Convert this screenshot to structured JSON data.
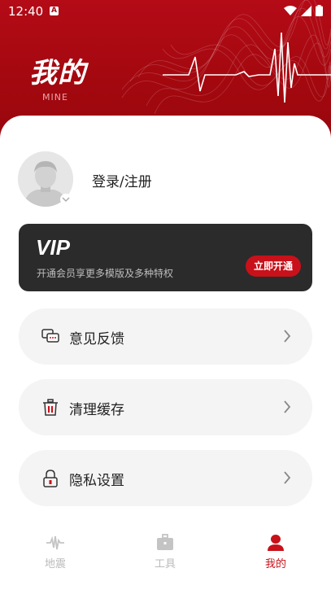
{
  "status_bar": {
    "time": "12:40",
    "app_badge": "A",
    "icons": [
      "wifi-icon",
      "signal-icon",
      "battery-icon"
    ]
  },
  "header": {
    "title": "我的",
    "subtitle": "MINE"
  },
  "profile": {
    "login_label": "登录/注册"
  },
  "vip": {
    "logo_text": "VIP",
    "description": "开通会员享更多模版及多种特权",
    "button_label": "立即开通"
  },
  "menu": [
    {
      "label": "意见反馈",
      "icon": "feedback-icon"
    },
    {
      "label": "清理缓存",
      "icon": "trash-icon"
    },
    {
      "label": "隐私设置",
      "icon": "lock-icon"
    }
  ],
  "tabs": [
    {
      "label": "地震",
      "icon": "seismograph-icon",
      "active": false
    },
    {
      "label": "工具",
      "icon": "toolbox-icon",
      "active": false
    },
    {
      "label": "我的",
      "icon": "user-icon",
      "active": true
    }
  ],
  "colors": {
    "brand_red": "#a3080f",
    "accent_red": "#c8111a",
    "tab_inactive": "#bbbbbb",
    "vip_card": "#2b2b2b",
    "menu_bg": "#f4f4f4"
  }
}
